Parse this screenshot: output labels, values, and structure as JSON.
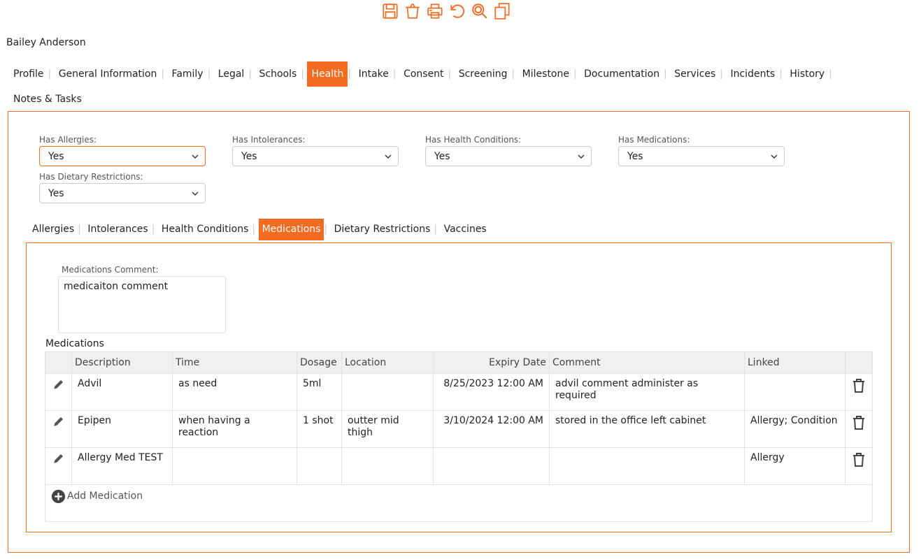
{
  "client": {
    "name": "Bailey Anderson"
  },
  "toolbar": {
    "icons": [
      "save-icon",
      "clear-icon",
      "print-icon",
      "undo-icon",
      "search-icon",
      "copy-icon"
    ]
  },
  "main_tabs": [
    {
      "label": "Profile"
    },
    {
      "label": "General Information"
    },
    {
      "label": "Family"
    },
    {
      "label": "Legal"
    },
    {
      "label": "Schools"
    },
    {
      "label": "Health"
    },
    {
      "label": "Intake"
    },
    {
      "label": "Consent"
    },
    {
      "label": "Screening"
    },
    {
      "label": "Milestone"
    },
    {
      "label": "Documentation"
    },
    {
      "label": "Services"
    },
    {
      "label": "Incidents"
    },
    {
      "label": "History"
    },
    {
      "label": "Notes & Tasks"
    }
  ],
  "active_main_tab": "Health",
  "fields": {
    "has_allergies": {
      "label": "Has Allergies:",
      "value": "Yes"
    },
    "has_intolerances": {
      "label": "Has Intolerances:",
      "value": "Yes"
    },
    "has_health_conditions": {
      "label": "Has Health Conditions:",
      "value": "Yes"
    },
    "has_medications": {
      "label": "Has Medications:",
      "value": "Yes"
    },
    "has_dietary_restrictions": {
      "label": "Has Dietary Restrictions:",
      "value": "Yes"
    }
  },
  "sub_tabs": [
    {
      "label": "Allergies"
    },
    {
      "label": "Intolerances"
    },
    {
      "label": "Health Conditions"
    },
    {
      "label": "Medications"
    },
    {
      "label": "Dietary Restrictions"
    },
    {
      "label": "Vaccines"
    }
  ],
  "active_sub_tab": "Medications",
  "medications": {
    "comment_label": "Medications Comment:",
    "comment_value": "medicaiton comment",
    "table_title": "Medications",
    "columns": [
      "Description",
      "Time",
      "Dosage",
      "Location",
      "Expiry Date",
      "Comment",
      "Linked"
    ],
    "rows": [
      {
        "description": "Advil",
        "time": "as need",
        "dosage": "5ml",
        "location": "",
        "expiry": "8/25/2023 12:00 AM",
        "comment": "advil comment administer as required",
        "linked": ""
      },
      {
        "description": "Epipen",
        "time": "when having a reaction",
        "dosage": "1 shot",
        "location": "outter mid thigh",
        "expiry": "3/10/2024 12:00 AM",
        "comment": "stored in the office left cabinet",
        "linked": "Allergy; Condition"
      },
      {
        "description": "Allergy Med TEST",
        "time": "",
        "dosage": "",
        "location": "",
        "expiry": "",
        "comment": "",
        "linked": "Allergy"
      }
    ],
    "add_label": "Add Medication"
  },
  "colors": {
    "accent": "#f26b21",
    "border": "#e2e2e2",
    "header_bg": "#f0f0f0"
  }
}
